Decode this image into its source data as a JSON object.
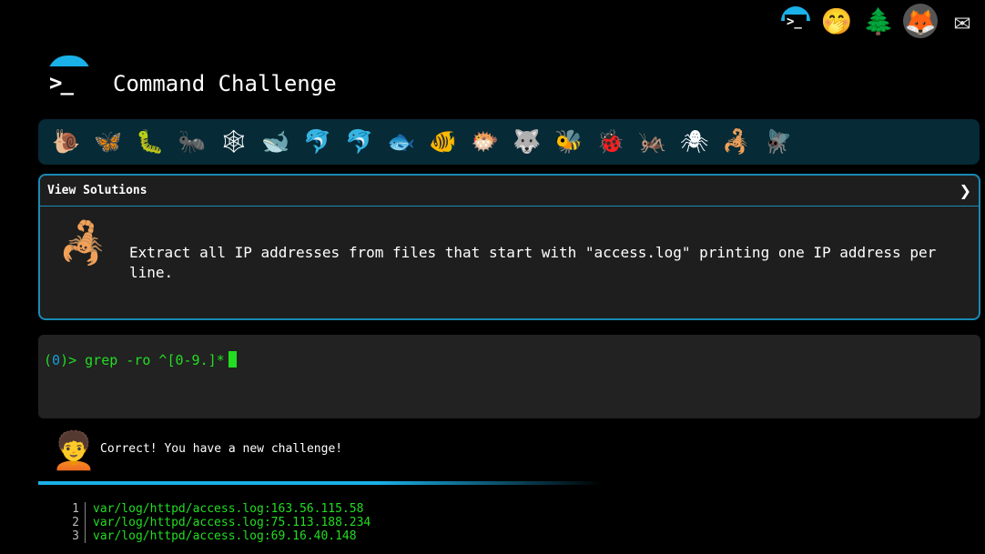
{
  "top_icons": [
    {
      "name": "terminal-logo-icon",
      "glyph": ">_"
    },
    {
      "name": "shushing-face-icon",
      "glyph": "🤭"
    },
    {
      "name": "tree-icon",
      "glyph": "🌲"
    },
    {
      "name": "gitlab-icon",
      "glyph": "🦊"
    },
    {
      "name": "envelope-icon",
      "glyph": "✉"
    }
  ],
  "header": {
    "logo_prompt": ">_",
    "title": "Command Challenge"
  },
  "animals": [
    "🐌",
    "🦋",
    "🐛",
    "🐜",
    "🕸",
    "🐋",
    "🐬",
    "🐬",
    "🐟",
    "🐠",
    "🐡",
    "🐺",
    "🐝",
    "🐞",
    "🦗",
    "🕷",
    "🦂",
    "🪰"
  ],
  "panel": {
    "view_solutions": "View Solutions",
    "chevron": "❯",
    "challenge_icon": "🦂",
    "challenge_text": "Extract all IP addresses from files that start with \"access.log\" printing one IP address per line."
  },
  "terminal": {
    "prompt_open": "(",
    "count": "0",
    "prompt_close": ")> ",
    "command": "grep -ro ^[0-9.]*"
  },
  "result": {
    "avatar": "🧑‍🦱",
    "message": "Correct! You have a new challenge!"
  },
  "output": [
    {
      "n": "1",
      "text": "var/log/httpd/access.log:163.56.115.58"
    },
    {
      "n": "2",
      "text": "var/log/httpd/access.log:75.113.188.234"
    },
    {
      "n": "3",
      "text": "var/log/httpd/access.log:69.16.40.148"
    }
  ],
  "colors": {
    "accent": "#1ab0e8",
    "terminal_green": "#22dd22",
    "panel_border": "#1a8ab3",
    "animal_bar_bg": "#062a36"
  }
}
